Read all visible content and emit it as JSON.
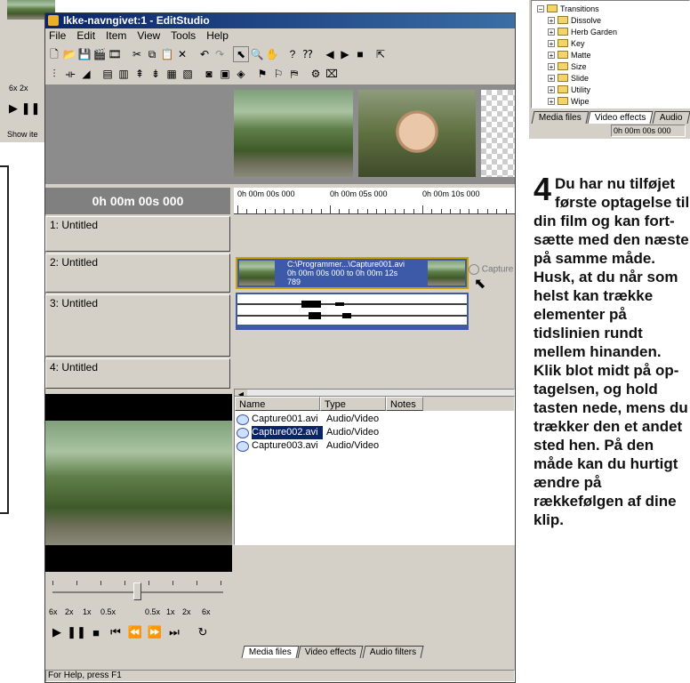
{
  "app": {
    "title": "Ikke-navngivet:1 - EditStudio",
    "menu": [
      "File",
      "Edit",
      "Item",
      "View",
      "Tools",
      "Help"
    ],
    "status": "For Help, press F1"
  },
  "toolbar1": [
    "new-icon",
    "open-icon",
    "save-icon",
    "capture-icon",
    "film-icon",
    "cut-icon",
    "copy-icon",
    "paste-icon",
    "delete-icon",
    "undo-icon",
    "redo-icon",
    "pointer-icon",
    "zoom-icon",
    "hand-icon",
    "help-icon",
    "context-help-icon",
    "prev-icon",
    "next-icon",
    "stop-icon",
    "export-icon"
  ],
  "timeline": {
    "time_display": "0h 00m 00s 000",
    "ruler": [
      "0h 00m 00s 000",
      "0h 00m 05s 000",
      "0h 00m 10s 000"
    ],
    "tracks": [
      "1: Untitled",
      "2: Untitled",
      "3: Untitled",
      "4: Untitled"
    ],
    "clip": {
      "line1": "C:\\Programmer...\\Capture001.avi",
      "line2": "0h 00m 00s 000 to 0h 00m 12s",
      "line3": "789"
    },
    "ghost_label": "Capture"
  },
  "media": {
    "columns": [
      "Name",
      "Type",
      "Notes"
    ],
    "files": [
      {
        "name": "Capture001.avi",
        "type": "Audio/Video",
        "selected": false
      },
      {
        "name": "Capture002.avi",
        "type": "Audio/Video",
        "selected": true
      },
      {
        "name": "Capture003.avi",
        "type": "Audio/Video",
        "selected": false
      }
    ],
    "tabs": [
      "Media files",
      "Video effects",
      "Audio filters"
    ]
  },
  "player": {
    "speeds": [
      "6x",
      "2x",
      "1x",
      "0.5x",
      "0.5x",
      "1x",
      "2x",
      "6x"
    ],
    "slider_position": 0.5
  },
  "right_panel": {
    "tree_root": "Transitions",
    "tree": [
      "Dissolve",
      "Herb Garden",
      "Key",
      "Matte",
      "Size",
      "Slide",
      "Utility",
      "Wipe"
    ],
    "tabs": [
      "Media files",
      "Video effects",
      "Audio"
    ],
    "time": "0h 00m 00s 000"
  },
  "bg_left": {
    "speeds": "6x 2x",
    "status": "Show ite"
  },
  "article": {
    "number": "4",
    "text": "Du har nu tilføjet første optagelse til din film og kan fort-sætte med den næste på samme måde. Husk, at du når som helst kan trække elementer på tidslinien rundt mellem hinanden. Klik blot midt på op-tagelsen, og hold tasten nede, mens du trækker den et andet sted hen. På den måde kan du hurtigt ændre på rækkefølgen af dine klip."
  },
  "colors": {
    "title_bar": "#0a246a",
    "selection": "#0a246a",
    "clip_blue": "#3d5aa8"
  }
}
